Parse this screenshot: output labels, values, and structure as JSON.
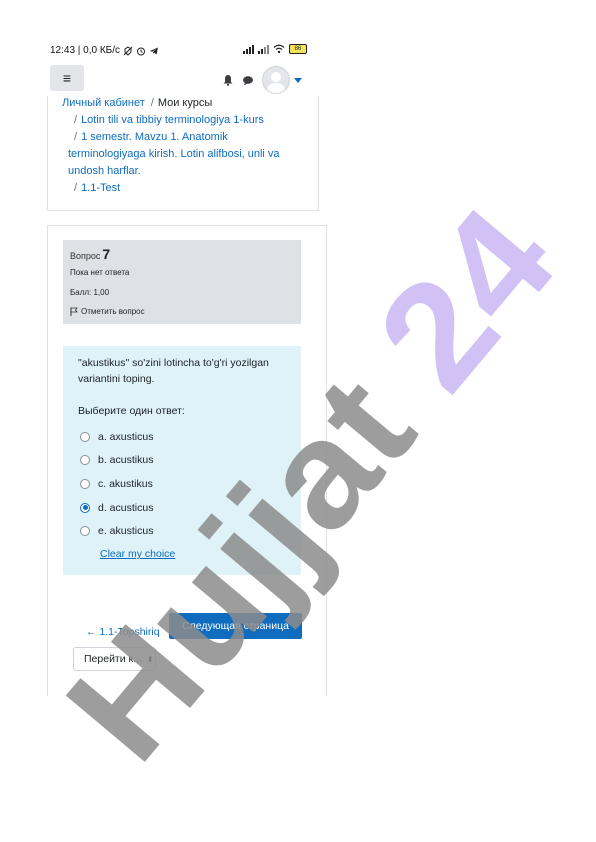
{
  "status_bar": {
    "time": "12:43 | 0,0 КБ/с",
    "battery": "86"
  },
  "breadcrumb": {
    "items": [
      "Личный кабинет",
      "Мои курсы",
      "Lotin tili va tibbiy terminologiya 1-kurs",
      "1 semestr. Mavzu 1. Anatomik terminologiyaga kirish. Lotin alifbosi, unli va undosh harflar.",
      "1.1-Test"
    ]
  },
  "question_info": {
    "label": "Вопрос",
    "number": "7",
    "state": "Пока нет ответа",
    "grade": "Балл: 1,00",
    "flag_label": "Отметить вопрос"
  },
  "question": {
    "text": "\"akustikus\" so'zini lotincha to'g'ri yozilgan variantini toping.",
    "prompt": "Выберите один ответ:",
    "options": [
      {
        "label": "a. axusticus",
        "selected": false
      },
      {
        "label": "b. acustikus",
        "selected": false
      },
      {
        "label": "c. akustikus",
        "selected": false
      },
      {
        "label": "d. acusticus",
        "selected": true
      },
      {
        "label": "e. akusticus",
        "selected": false
      }
    ],
    "clear_label": "Clear my choice"
  },
  "navigation": {
    "prev_label": "← 1.1-Topshiriq",
    "next_label": "Следующая страница",
    "jump_label": "Перейти к..."
  },
  "watermark": {
    "text": "Hujjat 24",
    "color": "#c9b6f2"
  },
  "colors": {
    "accent": "#0f6cbf",
    "info_bg": "#dee2e6",
    "content_bg": "#def2f8"
  }
}
